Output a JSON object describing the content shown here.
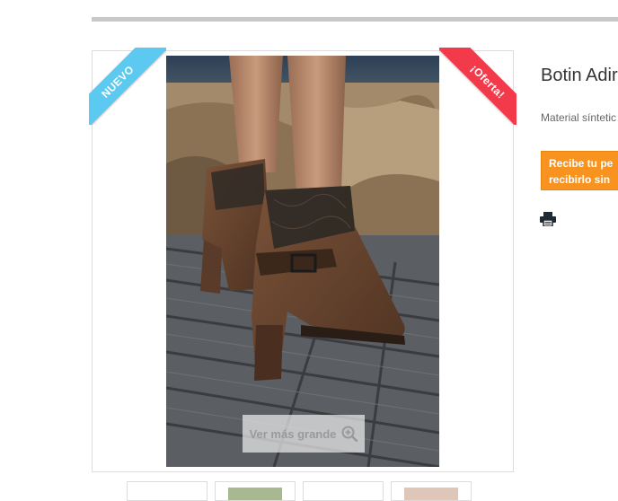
{
  "badges": {
    "new_label": "Nuevo",
    "sale_label": "¡Oferta!"
  },
  "product": {
    "title": "Botin Adir",
    "description": "Material síntetic",
    "promo_line1": "Recibe tu pe",
    "promo_line2": "recibirlo sin"
  },
  "image": {
    "zoom_label": "Ver más grande",
    "zoom_icon": "magnifier-plus-icon",
    "thumbnail_count": 4
  },
  "icons": {
    "print": "printer-icon"
  },
  "colors": {
    "new_badge": "#5bc9f0",
    "sale_badge": "#f23a4a",
    "promo_bg": "#f7931e",
    "divider": "#c8c8c8"
  }
}
